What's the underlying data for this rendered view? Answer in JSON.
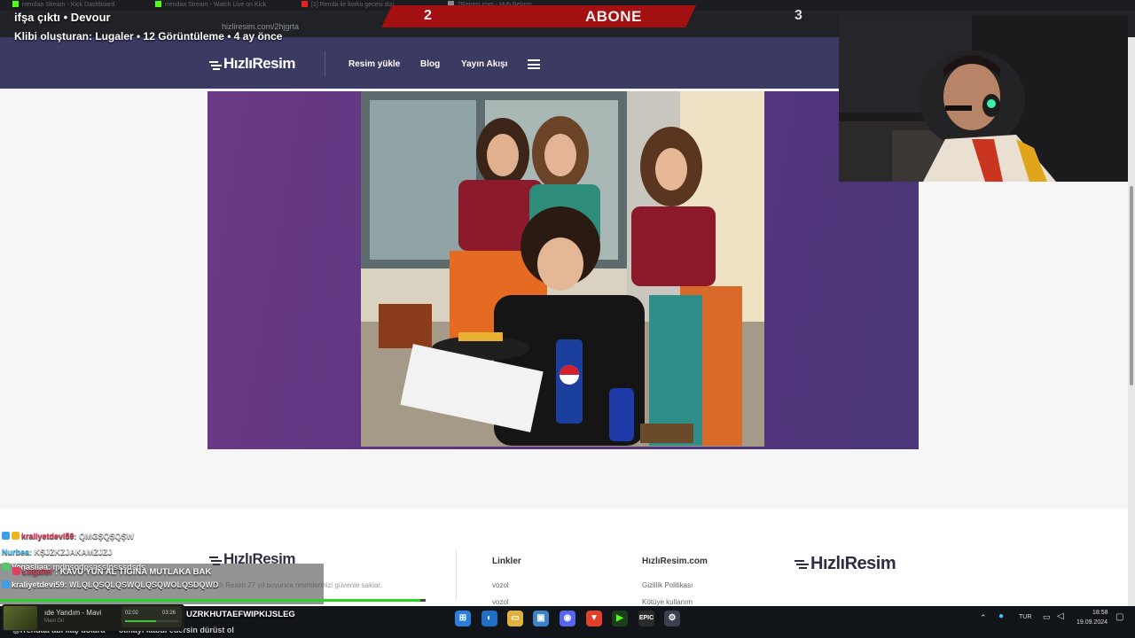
{
  "browser": {
    "tabs": [
      {
        "label": "rrendaa Stream - Kick Dashboard"
      },
      {
        "label": "rrendaa Stream - Watch Live on Kick"
      },
      {
        "label": "[1] Renda ile korku gecesi dizi"
      },
      {
        "label": "2Reigns.com - Hub Reigns"
      }
    ],
    "url": "hizliresim.com/2hjgrta"
  },
  "site": {
    "logo": "HızlıResim",
    "nav": [
      "Resim yükle",
      "Blog",
      "Yayın Akışı"
    ],
    "footer": {
      "logo": "HızlıResim",
      "description": "Hızlı Resim 27 yıl boyunca resimlerinizi güvenle saklar.",
      "links_title": "Linkler",
      "links": [
        "vozol",
        "vozol"
      ],
      "site_title": "HızlıResim.com",
      "site_links": [
        "Gizlilik Politikası",
        "Kötüye kullanım"
      ],
      "right_logo": "HızlıResim"
    }
  },
  "stream": {
    "clip_title": "ifşa çıktı • Devour",
    "clip_meta": "Klibi oluşturan: Lugaler • 12 Görüntüleme • 4 ay önce",
    "sub_goal": {
      "left": "2",
      "label": "ABONE",
      "right": "3"
    },
    "chat": [
      {
        "user": "kraliyetdevi59",
        "msg": ": QMGŞQŞQŞW"
      },
      {
        "user": "Nurbea",
        "msg": ": KŞJZKZJAKAMZJZJ"
      },
      {
        "user": "Vegasliaa",
        "msg": ": mdpsodpsasslpsssdsds"
      },
      {
        "user": "Lugaler",
        "msg": ": KAVU YUN AL TIGINA MUTLAKA BAK"
      },
      {
        "user": "kraliyetdevi59",
        "msg": ": WLQLQSQLQSWQLQSQWOLQSDQWD"
      },
      {
        "user": "",
        "msg": "UZRKHUTAEFWIPKIJSLEG"
      },
      {
        "user": "",
        "msg": "@rrendaa abi kaç dolara *** olmayı kabul edersin dürüst ol"
      }
    ],
    "music": {
      "title": "ıde Yandım - Mavi",
      "artist": "Mavi Gri",
      "elapsed": "02:02",
      "total": "03:26",
      "progress": 0.59
    },
    "alert_progress": 0.37
  },
  "taskbar": {
    "lang": "TUR",
    "time": "18:58",
    "date": "19.09.2024"
  },
  "colors": {
    "header": "#3b3a63",
    "sub_red": "#a31012",
    "chat_user": "#e23d5b",
    "progress_green": "#27d327"
  }
}
